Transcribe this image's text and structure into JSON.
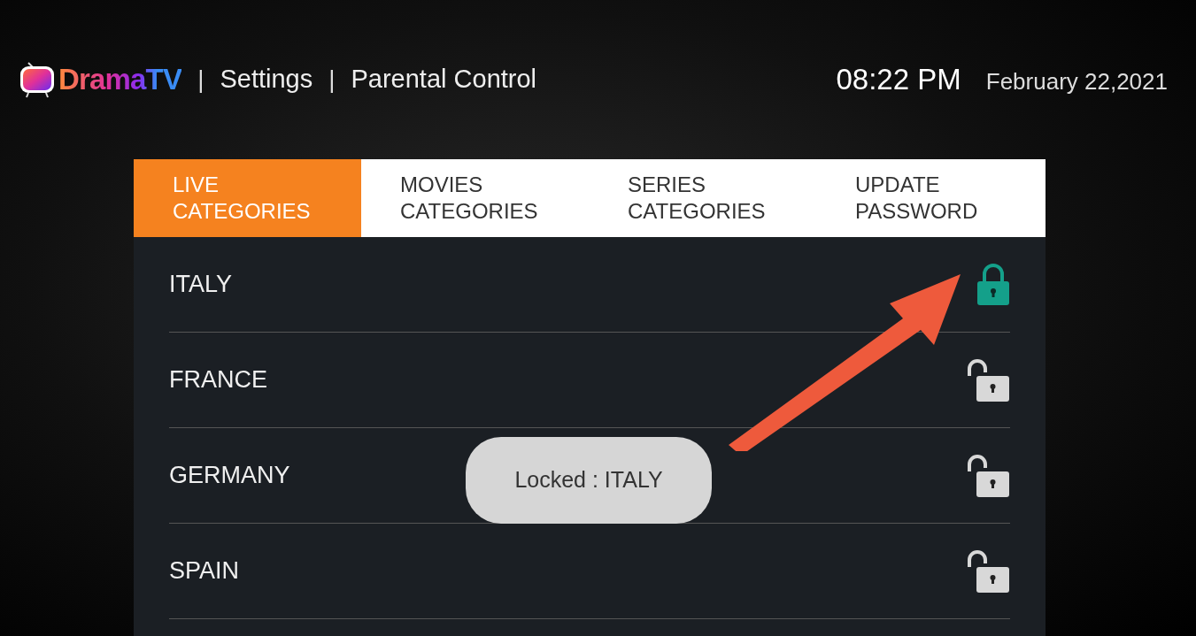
{
  "header": {
    "brand": "DramaTV",
    "separator": "|",
    "breadcrumb": [
      "Settings",
      "Parental Control"
    ],
    "time": "08:22 PM",
    "date": "February 22,2021"
  },
  "tabs": [
    {
      "label": "LIVE CATEGORIES",
      "selected": true
    },
    {
      "label": "MOVIES CATEGORIES",
      "selected": false
    },
    {
      "label": "SERIES CATEGORIES",
      "selected": false
    },
    {
      "label": "UPDATE PASSWORD",
      "selected": false
    }
  ],
  "categories": [
    {
      "name": "ITALY",
      "locked": true
    },
    {
      "name": "FRANCE",
      "locked": false
    },
    {
      "name": "GERMANY",
      "locked": false
    },
    {
      "name": "SPAIN",
      "locked": false
    }
  ],
  "toast": "Locked : ITALY"
}
